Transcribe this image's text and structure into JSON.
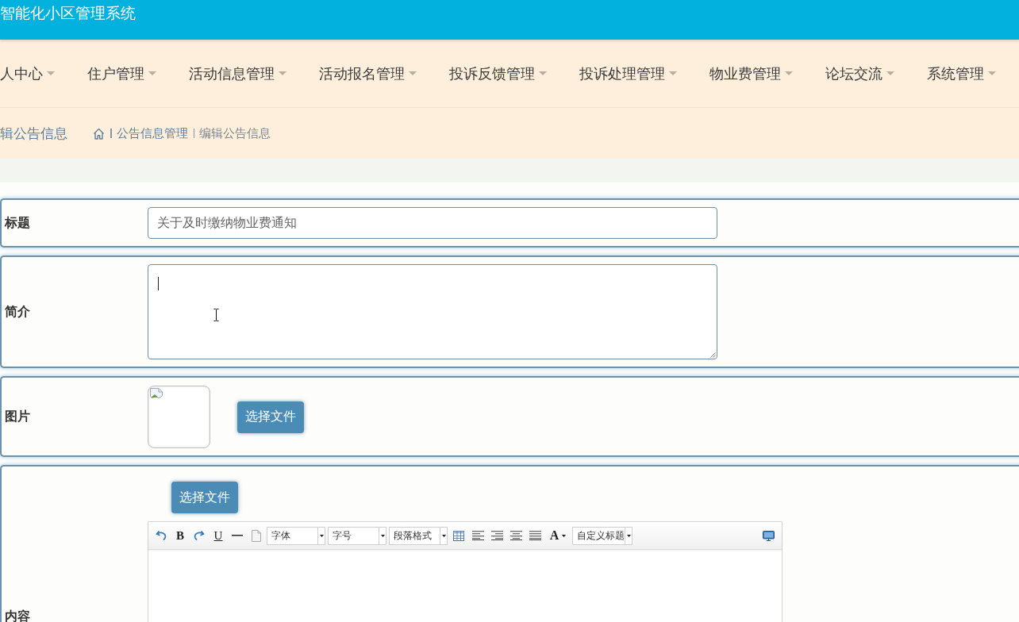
{
  "header": {
    "title": "智能化小区管理系统"
  },
  "nav": {
    "items": [
      {
        "label": "人中心"
      },
      {
        "label": "住户管理"
      },
      {
        "label": "活动信息管理"
      },
      {
        "label": "活动报名管理"
      },
      {
        "label": "投诉反馈管理"
      },
      {
        "label": "投诉处理管理"
      },
      {
        "label": "物业费管理"
      },
      {
        "label": "论坛交流"
      },
      {
        "label": "系统管理"
      }
    ]
  },
  "breadcrumb": {
    "page_title": "辑公告信息",
    "links": [
      {
        "label": "公告信息管理",
        "current": false
      },
      {
        "label": "编辑公告信息",
        "current": true
      }
    ]
  },
  "form": {
    "fields": [
      {
        "kind": "text",
        "label": "标题",
        "value": "关于及时缴纳物业费通知"
      },
      {
        "kind": "textarea",
        "label": "简介",
        "focused": true
      },
      {
        "kind": "image",
        "label": "图片",
        "button": "选择文件"
      },
      {
        "kind": "editor",
        "label": "内容",
        "button": "选择文件",
        "toolbar": [
          {
            "kind": "undo"
          },
          {
            "kind": "bold",
            "label": "B"
          },
          {
            "kind": "redo"
          },
          {
            "kind": "underline",
            "label": "U"
          },
          {
            "kind": "hr"
          },
          {
            "kind": "page"
          },
          {
            "kind": "select",
            "label": "字体"
          },
          {
            "kind": "select",
            "label": "字号"
          },
          {
            "kind": "select",
            "label": "段落格式"
          },
          {
            "kind": "table"
          },
          {
            "kind": "left"
          },
          {
            "kind": "right"
          },
          {
            "kind": "center"
          },
          {
            "kind": "justify"
          },
          {
            "kind": "fontcolor",
            "label": "A"
          },
          {
            "kind": "select",
            "label": "自定义标题"
          },
          {
            "kind": "fullscreen"
          }
        ]
      }
    ]
  }
}
